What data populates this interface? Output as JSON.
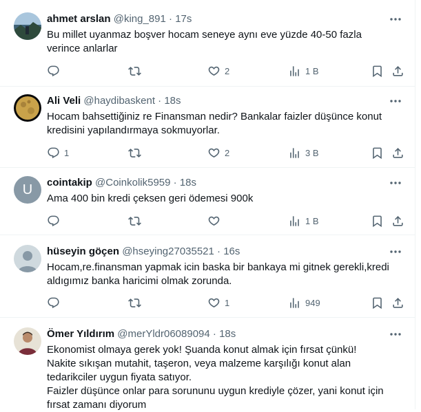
{
  "replies": [
    {
      "name": "ahmet arslan",
      "handle": "@king_891",
      "time": "17s",
      "avatar_icon": "landscape-photo-avatar",
      "text": [
        "Bu millet uyanmaz boşver hocam seneye aynı eve yüzde 40-50 fazla verince anlarlar"
      ],
      "reply_count": "",
      "retweet_count": "",
      "like_count": "2",
      "view_count": "1 B"
    },
    {
      "name": "Ali Veli",
      "handle": "@haydibaskent",
      "time": "18s",
      "avatar_icon": "moon-photo-avatar",
      "text": [
        "Hocam bahsettiğiniz re Finansman nedir? Bankalar faizler düşünce konut kredisini yapılandırmaya sokmuyorlar."
      ],
      "reply_count": "1",
      "retweet_count": "",
      "like_count": "2",
      "view_count": "3 B"
    },
    {
      "name": "cointakip",
      "handle": "@Coinkolik5959",
      "time": "18s",
      "avatar_icon": "letter-avatar",
      "avatar_letter": "U",
      "text": [
        "Ama 400 bin kredi çeksen geri ödemesi 900k"
      ],
      "reply_count": "",
      "retweet_count": "",
      "like_count": "",
      "view_count": "1 B"
    },
    {
      "name": "hüseyin göçen",
      "handle": "@hseying27035521",
      "time": "16s",
      "avatar_icon": "default-person-avatar",
      "text": [
        "Hocam,re.finansman yapmak icin baska bir bankaya mi gitnek gerekli,kredi aldıgımız banka haricimi olmak zorunda."
      ],
      "reply_count": "",
      "retweet_count": "",
      "like_count": "1",
      "view_count": "949"
    },
    {
      "name": "Ömer Yıldırım",
      "handle": "@merYldr06089094",
      "time": "18s",
      "avatar_icon": "person-photo-avatar",
      "text": [
        "Ekonomist olmaya gerek yok! Şuanda konut almak için fırsat çünkü!",
        "Nakite sıkışan mutahit, taşeron, veya malzeme karşılığı konut alan tedarikciler uygun fiyata satıyor.",
        "Faizler düşünce onlar para sorununu uygun krediyle çözer, yani konut için fırsat zamanı diyorum"
      ],
      "reply_count": "",
      "retweet_count": "",
      "like_count": "",
      "view_count": ""
    }
  ],
  "separator": "·",
  "colors": {
    "text": "#0f1419",
    "secondary": "#536471",
    "border": "#eff3f4"
  }
}
